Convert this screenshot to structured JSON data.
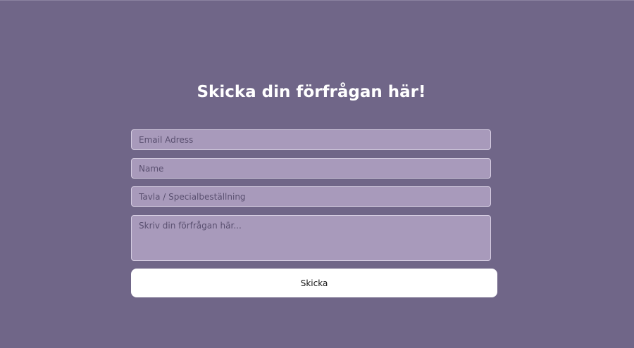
{
  "form": {
    "title": "Skicka din förfrågan här!",
    "email_placeholder": "Email Adress",
    "name_placeholder": "Name",
    "tavla_placeholder": "Tavla / Specialbeställning",
    "message_placeholder": "Skriv din förfrågan här...",
    "submit_label": "Skicka"
  },
  "colors": {
    "background": "#706688",
    "field_background": "#a89abb",
    "button_background": "#ffffff",
    "title_text": "#ffffff"
  }
}
